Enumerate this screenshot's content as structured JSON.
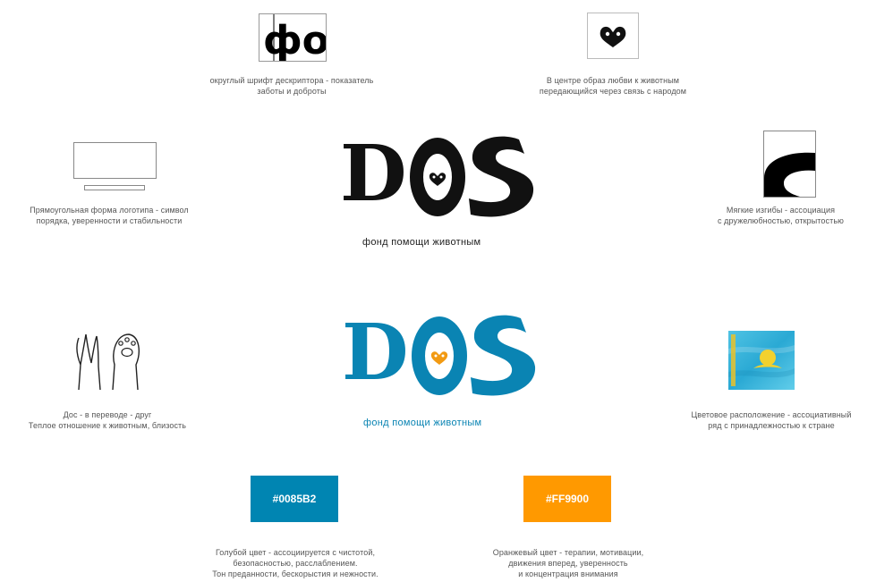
{
  "descriptor_sample": {
    "glyphs": "фо"
  },
  "notes": {
    "font": [
      "округлый шрифт дескриптора - показатель",
      "заботы и доброты"
    ],
    "center_love": [
      "В центре образ любви к животным",
      "передающийся через связь с народом"
    ],
    "rectangle": [
      "Прямоугольная форма логотипа - символ",
      "порядка, уверенности и стабильности"
    ],
    "curves": [
      "Мягкие изгибы - ассоциация",
      "с дружелюбностью, открытостью"
    ],
    "meaning": [
      "Дос - в переводе - друг",
      "Теплое отношение к животным, близость"
    ],
    "flag": [
      "Цветовое расположение - ассоциативный",
      "ряд с принадлежностью к стране"
    ],
    "blue": [
      "Голубой цвет - ассоциируется с чистотой,",
      "безопасностью, расслаблением.",
      "Тон преданности, бескорыстия и нежности."
    ],
    "orange": [
      "Оранжевый цвет - терапии, мотивации,",
      "движения вперед, уверенность",
      "и концентрация внимания"
    ]
  },
  "logo": {
    "word_left": "D",
    "word_right": "S",
    "tagline": "фонд помощи животным"
  },
  "swatches": {
    "blue": {
      "label": "#0085B2",
      "color": "#0085B2"
    },
    "orange": {
      "label": "#FF9900",
      "color": "#FF9900"
    }
  },
  "colors": {
    "black": "#111111",
    "blue": "#0A84B3",
    "orange": "#F29A12"
  }
}
